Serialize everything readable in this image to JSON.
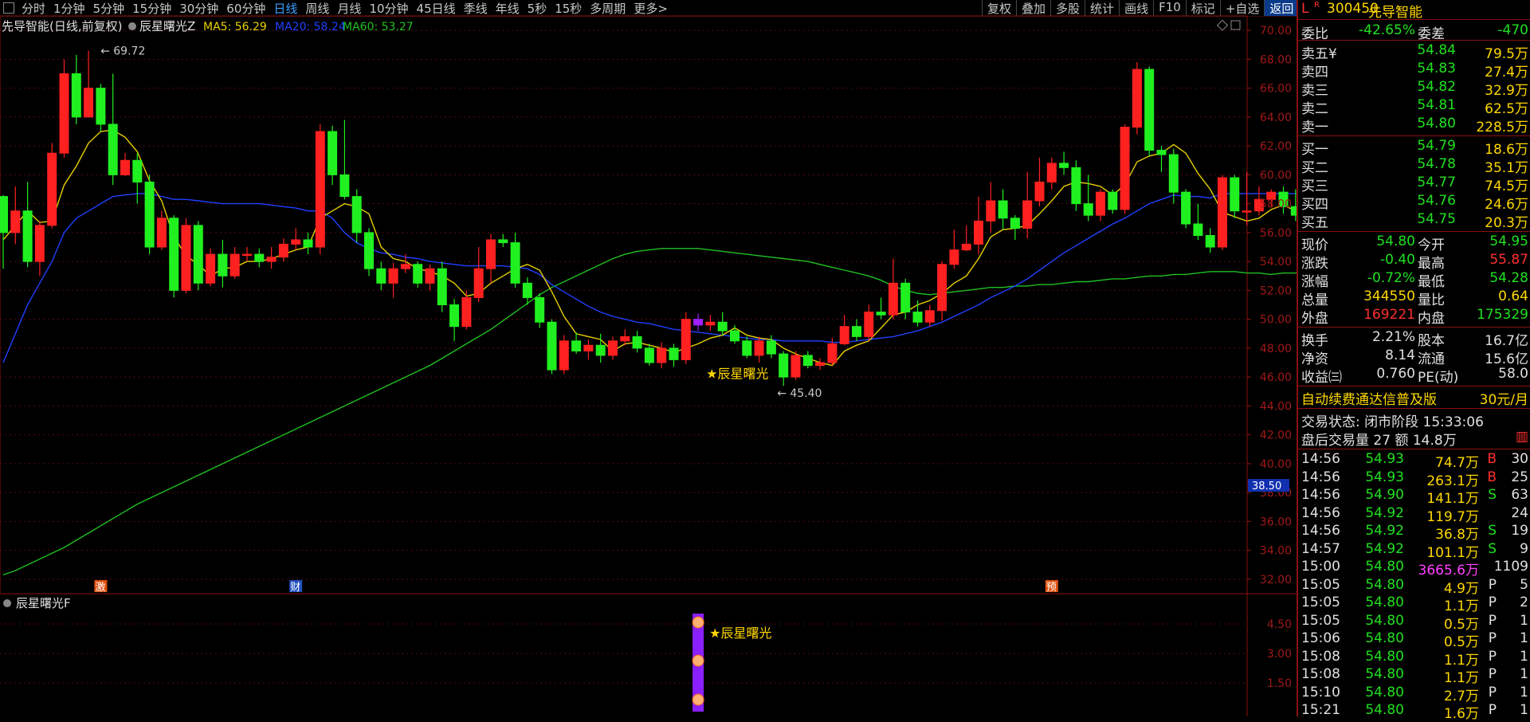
{
  "toolbar": {
    "periods": [
      "分时",
      "1分钟",
      "5分钟",
      "15分钟",
      "30分钟",
      "60分钟",
      "日线",
      "周线",
      "月线",
      "10分钟",
      "45日线",
      "季线",
      "年线",
      "5秒",
      "15秒",
      "多周期",
      "更多>"
    ],
    "active_period": "日线",
    "actions": [
      "复权",
      "叠加",
      "多股",
      "统计",
      "画线",
      "F10",
      "标记",
      "+自选",
      "返回"
    ]
  },
  "main_chart": {
    "title": "先导智能(日线,前复权)",
    "indicator": "辰星曙光Z",
    "ma_labels": [
      {
        "text": "MA5: 56.29",
        "color": "#e8d000"
      },
      {
        "text": "MA20: 58.24",
        "color": "#2040ff"
      },
      {
        "text": "MA60: 53.27",
        "color": "#20c020"
      }
    ],
    "high_marker": "69.72",
    "low_marker": "45.40",
    "signal_label": "★辰星曙光",
    "current_price_tag": "38.50",
    "event_badges": [
      {
        "text": "激",
        "index": 8,
        "color": "#e05010"
      },
      {
        "text": "财",
        "index": 24,
        "color": "#2050c0"
      },
      {
        "text": "预",
        "index": 86,
        "color": "#e05010"
      }
    ]
  },
  "sub_chart": {
    "title": "辰星曙光F",
    "signal_label": "★辰星曙光",
    "y_ticks": [
      "4.50",
      "3.00",
      "1.50"
    ]
  },
  "chart_data": {
    "type": "candlestick",
    "ylim": [
      31,
      71
    ],
    "y_ticks": [
      32,
      34,
      36,
      38,
      40,
      42,
      44,
      46,
      48,
      50,
      52,
      54,
      56,
      58,
      60,
      62,
      64,
      66,
      68,
      70
    ],
    "candles": [
      [
        58.5,
        56,
        58.6,
        53.5
      ],
      [
        56,
        57.5,
        59.2,
        55.2
      ],
      [
        57.5,
        54,
        59.5,
        53.6
      ],
      [
        54,
        56.5,
        56.8,
        53
      ],
      [
        56.5,
        61.5,
        62.2,
        56.3
      ],
      [
        61.5,
        67,
        68,
        61.2
      ],
      [
        67,
        64,
        68.3,
        63.5
      ],
      [
        64,
        66,
        68.6,
        64
      ],
      [
        66,
        63.5,
        66.3,
        63
      ],
      [
        63.5,
        60,
        67,
        59.3
      ],
      [
        60,
        61,
        61.5,
        59.9
      ],
      [
        61,
        59.5,
        61.5,
        58
      ],
      [
        59.5,
        55,
        60,
        54.5
      ],
      [
        55,
        57,
        57.5,
        54.8
      ],
      [
        57,
        52,
        57.2,
        51.5
      ],
      [
        52,
        56.5,
        57,
        51.8
      ],
      [
        56.5,
        52.5,
        56.8,
        52
      ],
      [
        52.5,
        54.5,
        54.9,
        52.3
      ],
      [
        54.5,
        53,
        55.5,
        52.2
      ],
      [
        53,
        54.5,
        55,
        52.8
      ],
      [
        54.5,
        54.5,
        55,
        54
      ],
      [
        54.5,
        54,
        54.9,
        53.6
      ],
      [
        54,
        54.3,
        55,
        53.5
      ],
      [
        54.3,
        55.2,
        55.6,
        54
      ],
      [
        55.2,
        55.5,
        56.3,
        54.8
      ],
      [
        55.5,
        55,
        56,
        54.5
      ],
      [
        55,
        63,
        63.5,
        54.5
      ],
      [
        63,
        60,
        63.4,
        59.3
      ],
      [
        60,
        58.5,
        63.8,
        58.3
      ],
      [
        58.5,
        56,
        59,
        55.3
      ],
      [
        56,
        53.5,
        56.3,
        53
      ],
      [
        53.5,
        52.5,
        54,
        52
      ],
      [
        52.5,
        53.5,
        53.9,
        51.5
      ],
      [
        53.5,
        53.8,
        54.5,
        53.2
      ],
      [
        53.8,
        52.5,
        54,
        52.2
      ],
      [
        52.5,
        53.5,
        53.8,
        52
      ],
      [
        53.5,
        51,
        54,
        50.5
      ],
      [
        51,
        49.5,
        51.4,
        48.5
      ],
      [
        49.5,
        51.5,
        52,
        49.3
      ],
      [
        51.5,
        53.5,
        55,
        51.2
      ],
      [
        53.5,
        55.5,
        55.9,
        52.5
      ],
      [
        55.5,
        55.3,
        55.9,
        55
      ],
      [
        55.3,
        52.5,
        56,
        52.2
      ],
      [
        52.5,
        51.5,
        52.9,
        51
      ],
      [
        51.5,
        49.8,
        51.8,
        49.4
      ],
      [
        49.8,
        46.5,
        50,
        46.2
      ],
      [
        46.5,
        48.5,
        48.9,
        46.2
      ],
      [
        48.5,
        47.8,
        49.1,
        47.6
      ],
      [
        47.8,
        48.2,
        48.6,
        47.2
      ],
      [
        48.2,
        47.5,
        49,
        47
      ],
      [
        47.5,
        48.5,
        48.8,
        47.2
      ],
      [
        48.5,
        48.8,
        49.3,
        48.2
      ],
      [
        48.8,
        48,
        49.2,
        47.7
      ],
      [
        48,
        47,
        48.3,
        46.8
      ],
      [
        47,
        48,
        48.4,
        46.6
      ],
      [
        48,
        47.2,
        48.3,
        46.7
      ],
      [
        47.2,
        50,
        50.5,
        46.9
      ],
      [
        50,
        49.6,
        50.4,
        49.2
      ],
      [
        49.6,
        49.8,
        50.3,
        49.2
      ],
      [
        49.8,
        49.2,
        50.5,
        48.9
      ],
      [
        49.2,
        48.5,
        49.6,
        48.3
      ],
      [
        48.5,
        47.5,
        48.8,
        47.3
      ],
      [
        47.5,
        48.5,
        48.8,
        47
      ],
      [
        48.5,
        47.6,
        48.9,
        47.3
      ],
      [
        47.6,
        46,
        47.8,
        45.4
      ],
      [
        46,
        47.5,
        47.8,
        45.8
      ],
      [
        47.5,
        46.8,
        47.8,
        46.6
      ],
      [
        46.8,
        47,
        47.3,
        46.5
      ],
      [
        47,
        48.3,
        48.7,
        46.8
      ],
      [
        48.3,
        49.5,
        50.3,
        48.2
      ],
      [
        49.5,
        48.8,
        50,
        48.5
      ],
      [
        48.8,
        50.5,
        51,
        48.5
      ],
      [
        50.5,
        50.3,
        51.5,
        50
      ],
      [
        50.3,
        52.5,
        54.2,
        50
      ],
      [
        52.5,
        50.5,
        52.8,
        50
      ],
      [
        50.5,
        49.8,
        51.3,
        49.5
      ],
      [
        49.8,
        50.6,
        51,
        49.5
      ],
      [
        50.6,
        53.8,
        54,
        49.9
      ],
      [
        53.8,
        54.8,
        56.2,
        53.5
      ],
      [
        54.8,
        55.2,
        56.5,
        54.7
      ],
      [
        55.2,
        56.8,
        58.5,
        54.5
      ],
      [
        56.8,
        58.2,
        59.5,
        56
      ],
      [
        58.2,
        57,
        59,
        56.2
      ],
      [
        57,
        56.3,
        57.2,
        55.5
      ],
      [
        56.3,
        58.2,
        60.2,
        55.6
      ],
      [
        58.2,
        59.5,
        61.2,
        57.8
      ],
      [
        59.5,
        60.8,
        61.2,
        59
      ],
      [
        60.8,
        60.5,
        61.6,
        60
      ],
      [
        60.5,
        58,
        61,
        57.5
      ],
      [
        58,
        57.2,
        60,
        56.8
      ],
      [
        57.2,
        58.8,
        59,
        56.8
      ],
      [
        58.8,
        57.6,
        59,
        57.3
      ],
      [
        57.6,
        63.3,
        63.5,
        57.3
      ],
      [
        63.3,
        67.3,
        67.8,
        62.8
      ],
      [
        67.3,
        61.7,
        67.5,
        61.3
      ],
      [
        61.7,
        61.4,
        62,
        60.2
      ],
      [
        61.4,
        58.8,
        61.8,
        58
      ],
      [
        58.8,
        56.6,
        59,
        56.3
      ],
      [
        56.6,
        55.8,
        58,
        55.5
      ],
      [
        55.8,
        55,
        56.3,
        54.6
      ],
      [
        55,
        59.8,
        60,
        54.8
      ],
      [
        59.8,
        57.5,
        60,
        57
      ],
      [
        57.5,
        57.5,
        60.2,
        56.5
      ],
      [
        57.5,
        58.3,
        59.2,
        57.2
      ],
      [
        58.3,
        58.8,
        59,
        57.8
      ],
      [
        58.8,
        57.8,
        59.2,
        57.3
      ],
      [
        57.8,
        57.2,
        59,
        56.8
      ],
      [
        57.2,
        56,
        57.5,
        55.5
      ],
      [
        56,
        55.2,
        57.2,
        55
      ],
      [
        55.2,
        54.8,
        56.3,
        54.5
      ]
    ],
    "ma5": [
      55.5,
      56.5,
      57.5,
      56.7,
      56.8,
      59.3,
      60.6,
      62.2,
      63,
      63.1,
      62.6,
      61.6,
      59.6,
      58.2,
      55.7,
      54.4,
      53.8,
      53,
      53.5,
      53.6,
      54,
      54,
      54.2,
      54.5,
      54.8,
      55,
      57,
      57.5,
      58,
      57.8,
      57.3,
      55,
      54.2,
      54,
      53.5,
      53.3,
      53,
      52.5,
      51.6,
      51.8,
      52.5,
      53,
      53.5,
      53.8,
      53.4,
      51.9,
      50.2,
      49,
      48.8,
      48.6,
      47.8,
      48.3,
      48.4,
      48.2,
      48,
      47.7,
      48,
      48.3,
      48.7,
      48.9,
      49.4,
      48.9,
      48.7,
      48.6,
      48,
      47.6,
      47.3,
      47,
      46.8,
      47.8,
      48.2,
      48.5,
      49.4,
      50.3,
      50.5,
      51,
      51.3,
      51.8,
      52.5,
      53,
      54.2,
      55.7,
      56.2,
      56.3,
      56.5,
      57.3,
      58.2,
      59.2,
      59.5,
      59.4,
      59.2,
      58.6,
      59.3,
      60.9,
      61.3,
      61.5,
      62.1,
      61.5,
      60.1,
      59,
      57.4,
      57.1,
      56.8,
      57,
      57.6,
      57.9,
      57.5,
      57.3,
      56.9,
      56.29
    ],
    "ma20": [
      47,
      49,
      51,
      52.5,
      54,
      56,
      57,
      57.5,
      58,
      58.5,
      58.6,
      58.7,
      58.7,
      58.5,
      58.3,
      58.3,
      58.2,
      58.1,
      58,
      58,
      58,
      58,
      57.9,
      57.8,
      57.7,
      57.5,
      57.5,
      57,
      56,
      55.3,
      54.9,
      54.6,
      54.5,
      54.3,
      54.2,
      54,
      53.9,
      53.8,
      53.7,
      53.7,
      53.7,
      53.7,
      53.6,
      53.5,
      53.1,
      52.4,
      51.9,
      51.4,
      50.9,
      50.5,
      50.2,
      50,
      49.8,
      49.7,
      49.5,
      49.3,
      49.2,
      49.1,
      49,
      48.9,
      48.8,
      48.7,
      48.6,
      48.6,
      48.5,
      48.5,
      48.5,
      48.5,
      48.4,
      48.4,
      48.5,
      48.6,
      48.7,
      48.8,
      49,
      49.2,
      49.5,
      49.8,
      50.2,
      50.6,
      51,
      51.5,
      51.9,
      52.3,
      52.8,
      53.4,
      54,
      54.6,
      55.1,
      55.6,
      56.1,
      56.6,
      57,
      57.5,
      58,
      58.3,
      58.6,
      58.5,
      58.5,
      58.4,
      58.7,
      58.7,
      58.7,
      58.7,
      58.7,
      58.7,
      58.7,
      58.6,
      58.5,
      58.24
    ],
    "ma60": [
      32.3,
      32.6,
      33,
      33.4,
      33.8,
      34.2,
      34.7,
      35.2,
      35.7,
      36.2,
      36.7,
      37.2,
      37.6,
      38,
      38.4,
      38.8,
      39.2,
      39.6,
      40,
      40.4,
      40.8,
      41.2,
      41.6,
      42,
      42.4,
      42.8,
      43.2,
      43.6,
      44,
      44.4,
      44.8,
      45.2,
      45.6,
      46,
      46.4,
      46.8,
      47.3,
      47.8,
      48.3,
      48.8,
      49.3,
      49.9,
      50.5,
      51.1,
      51.7,
      52.2,
      52.6,
      53,
      53.4,
      53.8,
      54.2,
      54.5,
      54.7,
      54.8,
      54.9,
      54.9,
      54.9,
      54.9,
      54.8,
      54.7,
      54.6,
      54.5,
      54.4,
      54.3,
      54.2,
      54.1,
      54,
      53.8,
      53.6,
      53.4,
      53.2,
      53,
      52.7,
      52.3,
      52,
      51.8,
      51.7,
      51.8,
      51.9,
      52,
      52.1,
      52.2,
      52.2,
      52.3,
      52.3,
      52.4,
      52.4,
      52.5,
      52.6,
      52.6,
      52.7,
      52.8,
      52.8,
      52.9,
      53,
      53,
      53.1,
      53.1,
      53.2,
      53.3,
      53.3,
      53.3,
      53.2,
      53.2,
      53.1,
      53.2,
      53.2,
      53.2,
      53.3,
      53.27
    ],
    "signal_index": 57
  },
  "quote": {
    "code": "300450",
    "name": "先导智能",
    "wei_bi": {
      "label": "委比",
      "value": "-42.65%"
    },
    "wei_cha": {
      "label": "委差",
      "value": "-470"
    },
    "asks": [
      {
        "label": "卖五¥",
        "price": "54.84",
        "vol": "79.5万"
      },
      {
        "label": "卖四",
        "price": "54.83",
        "vol": "27.4万"
      },
      {
        "label": "卖三",
        "price": "54.82",
        "vol": "32.9万"
      },
      {
        "label": "卖二",
        "price": "54.81",
        "vol": "62.5万"
      },
      {
        "label": "卖一",
        "price": "54.80",
        "vol": "228.5万"
      }
    ],
    "bids": [
      {
        "label": "买一",
        "price": "54.79",
        "vol": "18.6万"
      },
      {
        "label": "买二",
        "price": "54.78",
        "vol": "35.1万"
      },
      {
        "label": "买三",
        "price": "54.77",
        "vol": "74.5万"
      },
      {
        "label": "买四",
        "price": "54.76",
        "vol": "24.6万"
      },
      {
        "label": "买五",
        "price": "54.75",
        "vol": "20.3万"
      }
    ],
    "stats": [
      {
        "l1": "现价",
        "v1": "54.80",
        "c1": "green",
        "l2": "今开",
        "v2": "54.95",
        "c2": "green"
      },
      {
        "l1": "涨跌",
        "v1": "-0.40",
        "c1": "green",
        "l2": "最高",
        "v2": "55.87",
        "c2": "red"
      },
      {
        "l1": "涨幅",
        "v1": "-0.72%",
        "c1": "green",
        "l2": "最低",
        "v2": "54.28",
        "c2": "green"
      },
      {
        "l1": "总量",
        "v1": "344550",
        "c1": "yellow",
        "l2": "量比",
        "v2": "0.64",
        "c2": "yellow"
      },
      {
        "l1": "外盘",
        "v1": "169221",
        "c1": "red",
        "l2": "内盘",
        "v2": "175329",
        "c2": "green"
      }
    ],
    "fundamentals": [
      {
        "l1": "换手",
        "v1": "2.21%",
        "l2": "股本",
        "v2": "16.7亿"
      },
      {
        "l1": "净资",
        "v1": "8.14",
        "l2": "流通",
        "v2": "15.6亿"
      },
      {
        "l1": "收益㈢",
        "v1": "0.760",
        "l2": "PE(动)",
        "v2": "58.0"
      }
    ],
    "ad_text": "自动续费通达信普及版",
    "ad_price": "30元/月",
    "trade_state": "交易状态: 闭市阶段 15:33:06",
    "after_hours": "盘后交易量 27 额 14.8万",
    "ticks": [
      {
        "t": "14:56",
        "p": "54.93",
        "v": "74.7万",
        "s": "B",
        "n": "30"
      },
      {
        "t": "14:56",
        "p": "54.93",
        "v": "263.1万",
        "s": "B",
        "n": "25"
      },
      {
        "t": "14:56",
        "p": "54.90",
        "v": "141.1万",
        "s": "S",
        "n": "63"
      },
      {
        "t": "14:56",
        "p": "54.92",
        "v": "119.7万",
        "s": "",
        "n": "24"
      },
      {
        "t": "14:56",
        "p": "54.92",
        "v": "36.8万",
        "s": "S",
        "n": "19"
      },
      {
        "t": "14:57",
        "p": "54.92",
        "v": "101.1万",
        "s": "S",
        "n": "9"
      },
      {
        "t": "15:00",
        "p": "54.80",
        "v": "3665.6万",
        "s": "",
        "n": "1109"
      },
      {
        "t": "15:05",
        "p": "54.80",
        "v": "4.9万",
        "s": "P",
        "n": "5"
      },
      {
        "t": "15:05",
        "p": "54.80",
        "v": "1.1万",
        "s": "P",
        "n": "2"
      },
      {
        "t": "15:05",
        "p": "54.80",
        "v": "0.5万",
        "s": "P",
        "n": "1"
      },
      {
        "t": "15:06",
        "p": "54.80",
        "v": "0.5万",
        "s": "P",
        "n": "1"
      },
      {
        "t": "15:08",
        "p": "54.80",
        "v": "1.1万",
        "s": "P",
        "n": "1"
      },
      {
        "t": "15:08",
        "p": "54.80",
        "v": "1.1万",
        "s": "P",
        "n": "1"
      },
      {
        "t": "15:10",
        "p": "54.80",
        "v": "2.7万",
        "s": "P",
        "n": "1"
      },
      {
        "t": "15:21",
        "p": "54.80",
        "v": "1.6万",
        "s": "P",
        "n": "1"
      }
    ]
  }
}
